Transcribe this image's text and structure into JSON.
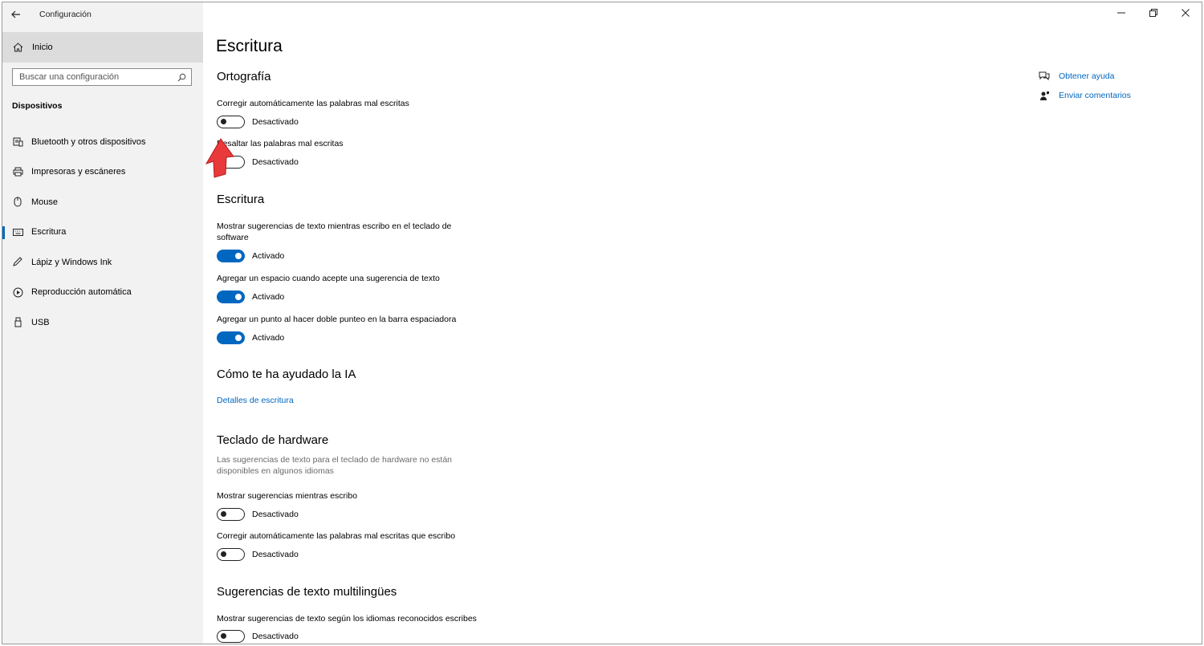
{
  "window": {
    "title": "Configuración",
    "controls": {
      "minimize": "—",
      "restore": "❐",
      "close": "✕"
    }
  },
  "sidebar": {
    "home_label": "Inicio",
    "search_placeholder": "Buscar una configuración",
    "section_title": "Dispositivos",
    "items": [
      {
        "label": "Bluetooth y otros dispositivos",
        "icon": "bluetooth-devices-icon"
      },
      {
        "label": "Impresoras y escáneres",
        "icon": "printer-icon"
      },
      {
        "label": "Mouse",
        "icon": "mouse-icon"
      },
      {
        "label": "Escritura",
        "icon": "keyboard-icon",
        "selected": true
      },
      {
        "label": "Lápiz y Windows Ink",
        "icon": "pen-icon"
      },
      {
        "label": "Reproducción automática",
        "icon": "autoplay-icon"
      },
      {
        "label": "USB",
        "icon": "usb-icon"
      }
    ]
  },
  "main": {
    "title": "Escritura",
    "ortografia": {
      "heading": "Ortografía",
      "autocorrect_label": "Corregir automáticamente las palabras mal escritas",
      "autocorrect_state": "Desactivado",
      "highlight_label": "Resaltar las palabras mal escritas",
      "highlight_state": "Desactivado"
    },
    "escritura": {
      "heading": "Escritura",
      "suggestions_label": "Mostrar sugerencias de texto mientras escribo en el teclado de software",
      "suggestions_state": "Activado",
      "space_label": "Agregar un espacio cuando acepte una sugerencia de texto",
      "space_state": "Activado",
      "period_label": "Agregar un punto al hacer doble punteo en la barra espaciadora",
      "period_state": "Activado"
    },
    "ia": {
      "heading": "Cómo te ha ayudado la IA",
      "link": "Detalles de escritura"
    },
    "hardware": {
      "heading": "Teclado de hardware",
      "description": "Las sugerencias de texto para el teclado de hardware no están disponibles en algunos idiomas",
      "suggestions_label": "Mostrar sugerencias mientras escribo",
      "suggestions_state": "Desactivado",
      "autocorrect_label": "Corregir automáticamente las palabras mal escritas que escribo",
      "autocorrect_state": "Desactivado"
    },
    "multilingual": {
      "heading": "Sugerencias de texto multilingües",
      "label": "Mostrar sugerencias de texto según los idiomas reconocidos escribes",
      "state": "Desactivado"
    }
  },
  "help": {
    "get_help": "Obtener ayuda",
    "feedback": "Enviar comentarios"
  },
  "colors": {
    "accent": "#0067c0",
    "sidebar_bg": "#f2f2f2",
    "annotation_arrow": "#e8393b"
  }
}
